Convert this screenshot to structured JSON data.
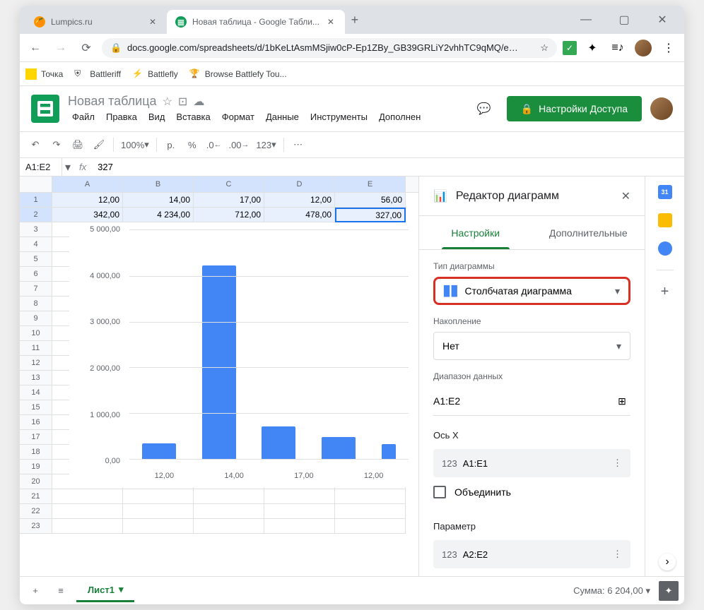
{
  "browser": {
    "tabs": [
      {
        "favicon_color": "#ff9800",
        "title": "Lumpics.ru"
      },
      {
        "favicon_color": "#0f9d58",
        "title": "Новая таблица - Google Табли..."
      }
    ],
    "url": "docs.google.com/spreadsheets/d/1bKeLtAsmMSjiw0cP-Ep1ZBy_GB39GRLiY2vhhTC9qMQ/e…",
    "bookmarks": [
      {
        "label": "Точка"
      },
      {
        "label": "Battleriff"
      },
      {
        "label": "Battlefly"
      },
      {
        "label": "Browse Battlefy Tou..."
      }
    ]
  },
  "doc": {
    "title": "Новая таблица",
    "menus": [
      "Файл",
      "Правка",
      "Вид",
      "Вставка",
      "Формат",
      "Данные",
      "Инструменты",
      "Дополнен"
    ],
    "share": "Настройки Доступа"
  },
  "toolbar": {
    "zoom": "100%",
    "currency": "р.",
    "percent": "%",
    "dec_dec": ".0",
    "inc_dec": ".00",
    "numfmt": "123"
  },
  "namebox": {
    "ref": "A1:E2",
    "formula": "327"
  },
  "sheet": {
    "cols": [
      "A",
      "B",
      "C",
      "D",
      "E"
    ],
    "rows": [
      [
        "12,00",
        "14,00",
        "17,00",
        "12,00",
        "56,00"
      ],
      [
        "342,00",
        "4 234,00",
        "712,00",
        "478,00",
        "327,00"
      ]
    ],
    "row_labels": [
      "1",
      "2",
      "3",
      "4",
      "5",
      "6",
      "7",
      "8",
      "9",
      "10",
      "11",
      "12",
      "13",
      "14",
      "15",
      "16",
      "17",
      "18",
      "19",
      "20",
      "21",
      "22",
      "23"
    ]
  },
  "chart_data": {
    "type": "bar",
    "categories": [
      "12,00",
      "14,00",
      "17,00",
      "12,00"
    ],
    "values": [
      342,
      4234,
      712,
      478
    ],
    "y_ticks": [
      "5 000,00",
      "4 000,00",
      "3 000,00",
      "2 000,00",
      "1 000,00",
      "0,00"
    ],
    "ylim": [
      0,
      5000
    ],
    "fifth_partial": 327
  },
  "panel": {
    "title": "Редактор диаграмм",
    "tabs": [
      "Настройки",
      "Дополнительные"
    ],
    "chart_type_label": "Тип диаграммы",
    "chart_type_value": "Столбчатая диаграмма",
    "stacking_label": "Накопление",
    "stacking_value": "Нет",
    "range_label": "Диапазон данных",
    "range_value": "A1:E2",
    "xaxis_label": "Ось X",
    "xaxis_value": "A1:E1",
    "combine_label": "Объединить",
    "series_label": "Параметр",
    "series_value": "A2:E2",
    "num_prefix": "123"
  },
  "bottom": {
    "sheet_name": "Лист1",
    "sum_label": "Сумма: 6 204,00"
  }
}
